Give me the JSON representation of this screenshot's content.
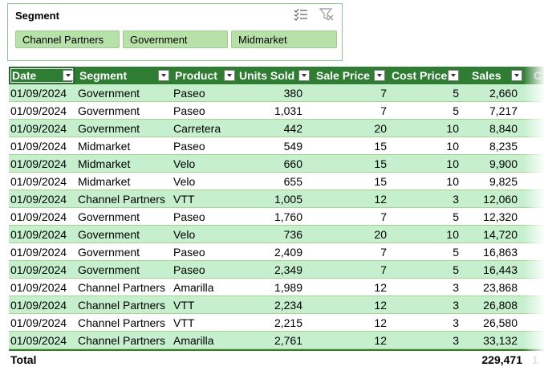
{
  "slicer": {
    "title": "Segment",
    "icons": [
      "multi-select-icon",
      "clear-filter-icon"
    ],
    "buttons": [
      "Channel Partners",
      "Government",
      "Midmarket"
    ],
    "selected_color": "#b7e1a8",
    "border_color": "#8fbf8f"
  },
  "table": {
    "header_color": "#2e7d32",
    "band_color": "#c6efce",
    "columns": [
      "Date",
      "Segment",
      "Product",
      "Units Sold",
      "Sale Price",
      "Cost Price",
      "Sales",
      "C"
    ],
    "rows": [
      [
        "01/09/2024",
        "Government",
        "Paseo",
        "380",
        "7",
        "5",
        "2,660"
      ],
      [
        "01/09/2024",
        "Government",
        "Paseo",
        "1,031",
        "7",
        "5",
        "7,217"
      ],
      [
        "01/09/2024",
        "Government",
        "Carretera",
        "442",
        "20",
        "10",
        "8,840"
      ],
      [
        "01/09/2024",
        "Midmarket",
        "Paseo",
        "549",
        "15",
        "10",
        "8,235"
      ],
      [
        "01/09/2024",
        "Midmarket",
        "Velo",
        "660",
        "15",
        "10",
        "9,900"
      ],
      [
        "01/09/2024",
        "Midmarket",
        "Velo",
        "655",
        "15",
        "10",
        "9,825"
      ],
      [
        "01/09/2024",
        "Channel Partners",
        "VTT",
        "1,005",
        "12",
        "3",
        "12,060"
      ],
      [
        "01/09/2024",
        "Government",
        "Paseo",
        "1,760",
        "7",
        "5",
        "12,320"
      ],
      [
        "01/09/2024",
        "Government",
        "Velo",
        "736",
        "20",
        "10",
        "14,720"
      ],
      [
        "01/09/2024",
        "Government",
        "Paseo",
        "2,409",
        "7",
        "5",
        "16,863"
      ],
      [
        "01/09/2024",
        "Government",
        "Paseo",
        "2,349",
        "7",
        "5",
        "16,443"
      ],
      [
        "01/09/2024",
        "Channel Partners",
        "Amarilla",
        "1,989",
        "12",
        "3",
        "23,868"
      ],
      [
        "01/09/2024",
        "Channel Partners",
        "VTT",
        "2,234",
        "12",
        "3",
        "26,808"
      ],
      [
        "01/09/2024",
        "Channel Partners",
        "VTT",
        "2,215",
        "12",
        "3",
        "26,580"
      ],
      [
        "01/09/2024",
        "Channel Partners",
        "Amarilla",
        "2,761",
        "12",
        "3",
        "33,132"
      ]
    ],
    "total": {
      "label": "Total",
      "sales": "229,471",
      "extra": "1"
    }
  }
}
